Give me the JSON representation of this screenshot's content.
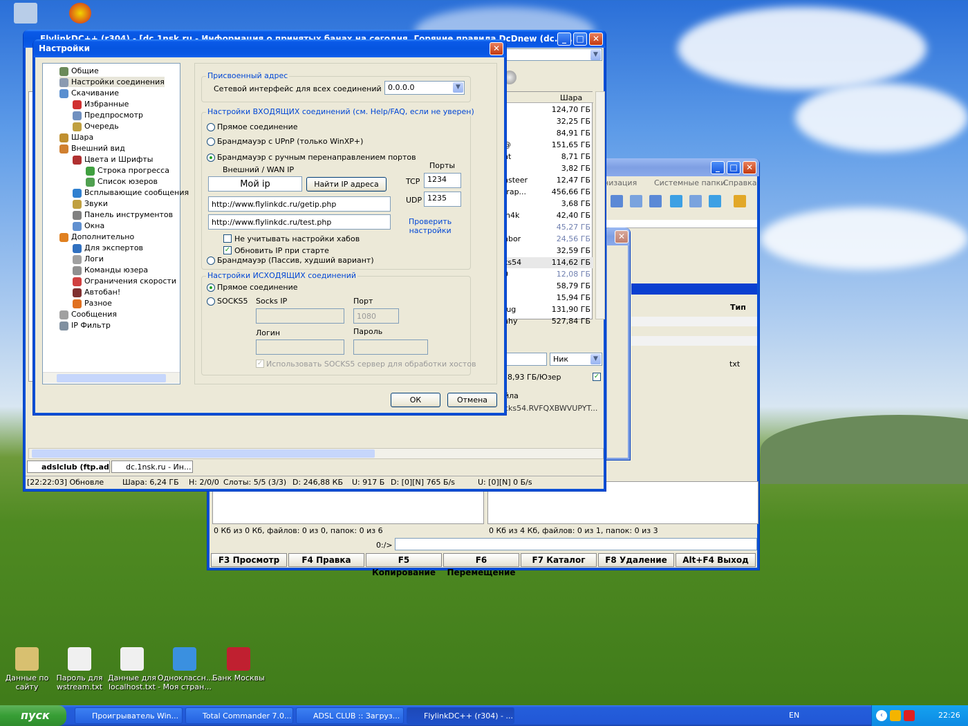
{
  "dialog": {
    "title": "Настройки",
    "ok": "ОК",
    "cancel": "Отмена"
  },
  "tree": [
    "Общие",
    "Настройки соединения",
    "Скачивание",
    "Избранные",
    "Предпросмотр",
    "Очередь",
    "Шара",
    "Внешний вид",
    "Цвета и Шрифты",
    "Строка прогресса",
    "Список юзеров",
    "Всплывающие сообщения",
    "Звуки",
    "Панель инструментов",
    "Окна",
    "Дополнительно",
    "Для экспертов",
    "Логи",
    "Команды юзера",
    "Ограничения скорости",
    "Автобан!",
    "Разное",
    "Сообщения",
    "IP Фильтр"
  ],
  "assigned": {
    "legend": "Присвоенный адрес",
    "label": "Сетевой интерфейс для всех соединений",
    "value": "0.0.0.0"
  },
  "incoming": {
    "legend": "Настройки ВХОДЯЩИХ соединений (см. Help/FAQ, если не уверен)",
    "direct": "Прямое соединение",
    "upnp": "Брандмауэр с UPnP (только WinXP+)",
    "manual": "Брандмауэр с ручным перенаправлением портов",
    "wan_label": "Внешний / WAN IP",
    "my_ip": "Мой ip",
    "find_ip": "Найти IP адреса",
    "ports": "Порты",
    "tcp": "TCP",
    "tcp_val": "1234",
    "udp": "UDP",
    "udp_val": "1235",
    "url1": "http://www.flylinkdc.ru/getip.php",
    "url2": "http://www.flylinkdc.ru/test.php",
    "check1": "Проверить",
    "check2": "настройки",
    "no_hub": "Не учитывать настройки хабов",
    "update_ip": "Обновить IP при старте",
    "passive": "Брандмауэр (Пассив, худший вариант)"
  },
  "outgoing": {
    "legend": "Настройки ИСХОДЯЩИХ соединений",
    "direct": "Прямое соединение",
    "socks": "SOCKS5",
    "socks_ip": "Socks IP",
    "port": "Порт",
    "port_val": "1080",
    "login": "Логин",
    "password": "Пароль",
    "use_socks": "Использовать SOCKS5 сервер для обработки хостов"
  },
  "flylink": {
    "title": "FlylinkDC++ (r304) - [dc.1nsk.ru - Информация о принятых банах на сегодня, Горячие правила DcDnew (dc.1n...",
    "shara": "Шара",
    "sizes": [
      "124,70 ГБ",
      "32,25 ГБ",
      "84,91 ГБ",
      "151,65 ГБ",
      "8,71 ГБ",
      "3,82 ГБ",
      "12,47 ГБ",
      "456,66 ГБ",
      "3,68 ГБ",
      "42,40 ГБ",
      "45,27 ГБ",
      "24,56 ГБ",
      "32,59 ГБ",
      "114,62 ГБ",
      "12,08 ГБ",
      "58,79 ГБ",
      "15,94 ГБ",
      "131,90 ГБ",
      "527,84 ГБ"
    ],
    "names": [
      "",
      "",
      "",
      "@",
      "nt",
      "",
      "nsteer",
      "trap...",
      "",
      "in4k",
      "",
      "nbor",
      "",
      "ks54",
      "0",
      "",
      "",
      "tug",
      "nhy"
    ],
    "tab1": "adslclub (ftp.ad...",
    "tab2": "dc.1nsk.ru - Ин...",
    "nick": "Ник",
    "user_share": "78,93 ГБ/Юзер",
    "file_label": "йла",
    "file_name": "cks54.RVFQXBWVUPYT...",
    "status": [
      "[22:22:03] Обновле",
      "Шара: 6,24 ГБ",
      "H: 2/0/0",
      "Слоты: 5/5 (3/3)",
      "D: 246,88 КБ",
      "U: 917 Б",
      "D: [0][N] 765 Б/s",
      "U: [0][N] 0 Б/s"
    ]
  },
  "tc": {
    "menu": [
      "низация",
      "Системные папки",
      "Справка"
    ],
    "type_col": "Тип",
    "ext": "txt",
    "left_info": "0 Кб из 0 Кб, файлов: 0 из 0, папок: 0 из 6",
    "right_info": "0 Кб из 4 Кб, файлов: 0 из 1, папок: 0 из 3",
    "path": "0:/>",
    "fkeys": [
      "F3 Просмотр",
      "F4 Правка",
      "F5 Копирование",
      "F6 Перемещение",
      "F7 Каталог",
      "F8 Удаление",
      "Alt+F4 Выход"
    ]
  },
  "desktop": [
    "Данные по сайту",
    "Пароль для wstream.txt",
    "Данные для localhost.txt",
    "Одноклассн... - Моя стран...",
    "Банк Москвы"
  ],
  "taskbar": {
    "start": "пуск",
    "tasks": [
      "Проигрыватель Win...",
      "Total Commander 7.0...",
      "ADSL CLUB :: Загруз...",
      "FlylinkDC++ (r304) - ..."
    ],
    "lang": "EN",
    "time": "22:26"
  }
}
